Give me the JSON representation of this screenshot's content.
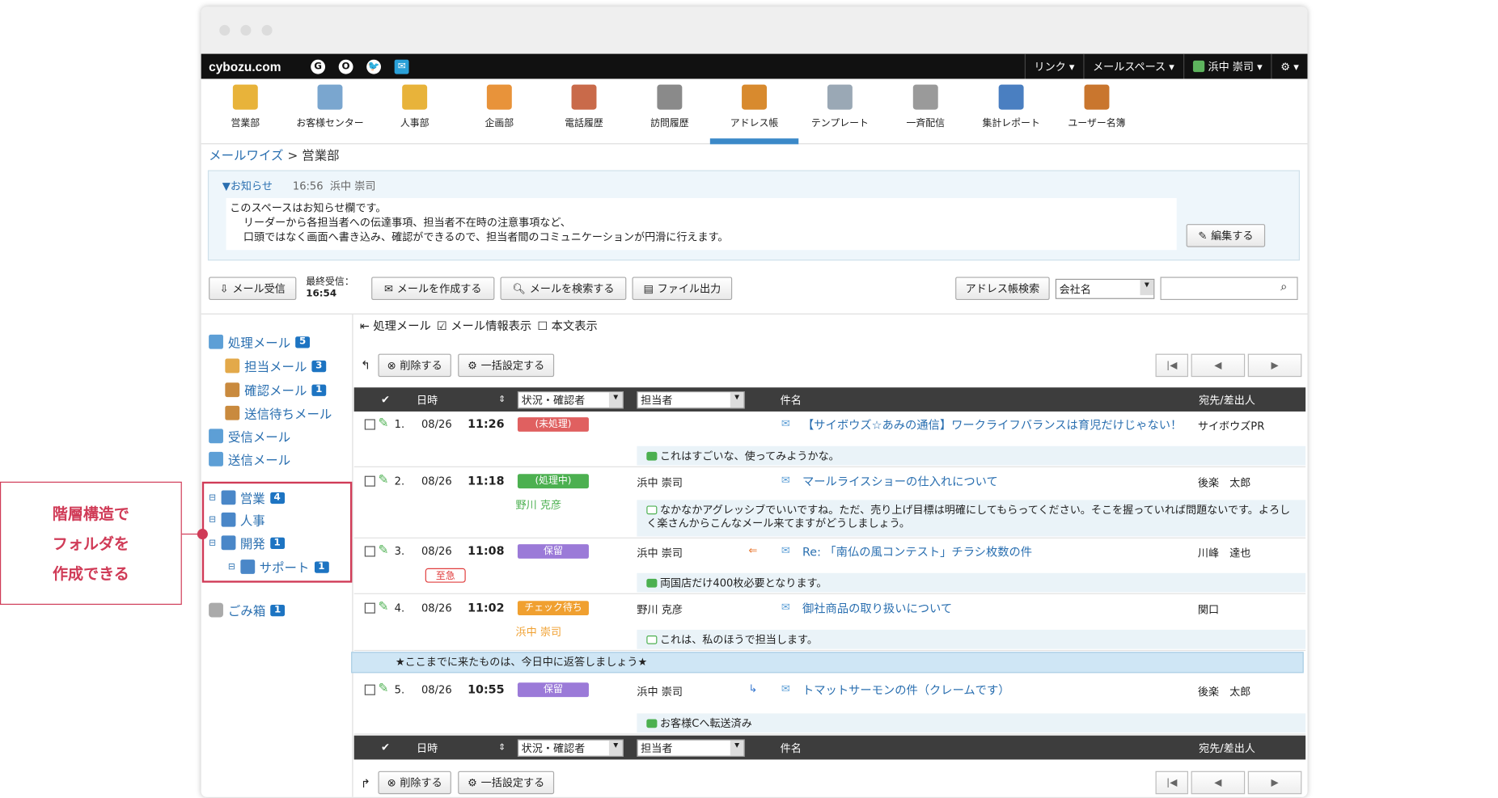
{
  "topbar": {
    "logo": "cybozu.com",
    "apps": [
      "G",
      "O",
      "🐦",
      "✉"
    ],
    "link": "リンク ▾",
    "mailspace": "メールスペース ▾",
    "user": "浜中 崇司 ▾",
    "gear": "⚙ ▾"
  },
  "nav": [
    {
      "label": "営業部",
      "icon": "folder-mail-icon",
      "color": "#e8b33a"
    },
    {
      "label": "お客様センター",
      "icon": "folder-mail-icon",
      "color": "#7aa6cf"
    },
    {
      "label": "人事部",
      "icon": "folder-mail-icon",
      "color": "#e8b33a"
    },
    {
      "label": "企画部",
      "icon": "folder-mail-icon",
      "color": "#e8933a"
    },
    {
      "label": "電話履歴",
      "icon": "phone-log-icon",
      "color": "#c96a4a"
    },
    {
      "label": "訪問履歴",
      "icon": "visit-log-icon",
      "color": "#8a8a8a"
    },
    {
      "label": "アドレス帳",
      "icon": "address-book-icon",
      "color": "#d88a2e"
    },
    {
      "label": "テンプレート",
      "icon": "template-icon",
      "color": "#9aa8b5"
    },
    {
      "label": "一斉配信",
      "icon": "broadcast-icon",
      "color": "#9a9a9a"
    },
    {
      "label": "集計レポート",
      "icon": "report-icon",
      "color": "#4a7fc1"
    },
    {
      "label": "ユーザー名簿",
      "icon": "user-list-icon",
      "color": "#c9762e"
    }
  ],
  "breadcrumb": {
    "root": "メールワイズ",
    "sep": " > ",
    "current": "営業部"
  },
  "notice": {
    "title": "▼お知らせ",
    "time": "16:56",
    "author": "浜中 崇司",
    "lines": [
      "このスペースはお知らせ欄です。",
      "リーダーから各担当者への伝達事項、担当者不在時の注意事項など、",
      "口頭ではなく画面へ書き込み、確認ができるので、担当者間のコミュニケーションが円滑に行えます。"
    ],
    "edit": "編集する"
  },
  "toolbar": {
    "receive": "メール受信",
    "last_label": "最終受信：",
    "last_time": "16:54",
    "compose": "メールを作成する",
    "search": "メールを検索する",
    "export": "ファイル出力",
    "addr_search": "アドレス帳検索",
    "company": "会社名",
    "search_value": ""
  },
  "sidebar": {
    "processing": "処理メール",
    "processing_count": "5",
    "assigned": "担当メール",
    "assigned_count": "3",
    "confirm": "確認メール",
    "confirm_count": "1",
    "pending": "送信待ちメール",
    "inbox": "受信メール",
    "sent": "送信メール",
    "folders": [
      {
        "label": "営業",
        "count": "4"
      },
      {
        "label": "人事",
        "count": ""
      },
      {
        "label": "開発",
        "count": "1"
      },
      {
        "label": "サポート",
        "count": "1"
      }
    ],
    "trash": "ごみ箱",
    "trash_count": "1"
  },
  "list": {
    "tab": "処理メール",
    "show_info": "メール情報表示",
    "show_body": "本文表示",
    "delete": "削除する",
    "bulk": "一括設定する",
    "headers": {
      "date": "日時",
      "status": "状況・確認者",
      "assignee": "担当者",
      "subject": "件名",
      "to": "宛先/差出人"
    },
    "rows": [
      {
        "no": "1.",
        "date": "08/26",
        "time": "11:26",
        "status": "(未処理)",
        "status_color": "#e06060",
        "assignee": "",
        "confirmer": "",
        "subject": "【サイボウズ☆あみの通信】ワークライフバランスは育児だけじゃない！",
        "to": "サイボウズPR",
        "memo": "これはすごいな、使ってみようかな。",
        "memo_color": "#4cb050",
        "arrow": "",
        "urgent": ""
      },
      {
        "no": "2.",
        "date": "08/26",
        "time": "11:18",
        "status": "(処理中)",
        "status_color": "#4cb050",
        "assignee": "浜中 崇司",
        "confirmer": "野川 克彦",
        "subject": "マールライスショーの仕入れについて",
        "to": "後楽　太郎",
        "memo": "なかなかアグレッシブでいいですね。ただ、売り上げ目標は明確にしてもらってください。そこを握っていれば問題ないです。よろしく楽さんからこんなメール来てますがどうしましょう。",
        "memo_color": "#fff",
        "arrow": "",
        "urgent": ""
      },
      {
        "no": "3.",
        "date": "08/26",
        "time": "11:08",
        "status": "保留",
        "status_color": "#9b7ad8",
        "assignee": "浜中 崇司",
        "confirmer": "",
        "subject": "Re: 「南仏の風コンテスト」チラシ枚数の件",
        "to": "川峰　達也",
        "memo": "両国店だけ400枚必要となります。",
        "memo_color": "#4cb050",
        "arrow": "⇐",
        "urgent": "至急"
      },
      {
        "no": "4.",
        "date": "08/26",
        "time": "11:02",
        "status": "チェック待ち",
        "status_color": "#f0a030",
        "assignee": "野川 克彦",
        "confirmer": "浜中 崇司",
        "subject": "御社商品の取り扱いについて",
        "to": "関口",
        "memo": "これは、私のほうで担当します。",
        "memo_color": "#fff",
        "arrow": "",
        "urgent": ""
      },
      {
        "no": "5.",
        "date": "08/26",
        "time": "10:55",
        "status": "保留",
        "status_color": "#9b7ad8",
        "assignee": "浜中 崇司",
        "confirmer": "",
        "subject": "トマットサーモンの件（クレームです）",
        "to": "後楽　太郎",
        "memo": "お客様Cへ転送済み",
        "memo_color": "#4cb050",
        "arrow": "↳",
        "urgent": ""
      }
    ],
    "ribbon": "★ここまでに来たものは、今日中に返答しましょう★"
  },
  "callout": [
    "階層構造で",
    "フォルダを",
    "作成できる"
  ]
}
